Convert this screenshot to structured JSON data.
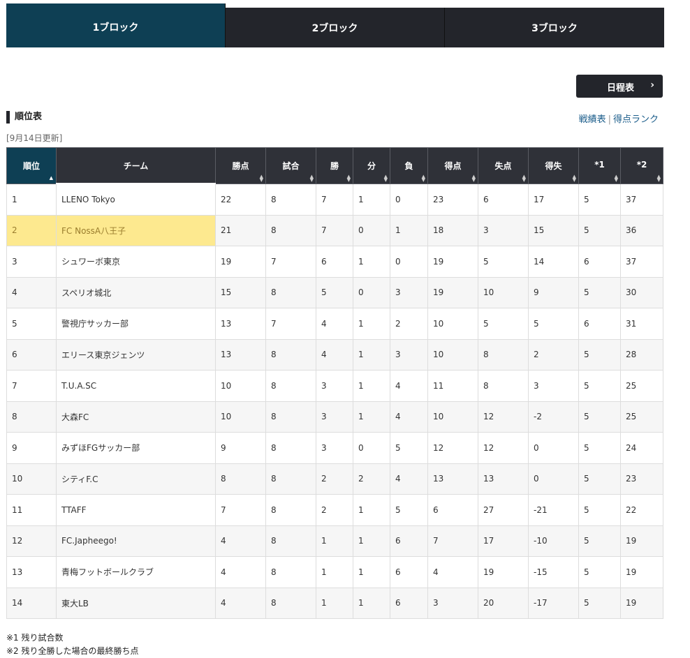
{
  "tabs": [
    {
      "label": "1ブロック",
      "active": true
    },
    {
      "label": "2ブロック",
      "active": false
    },
    {
      "label": "3ブロック",
      "active": false
    }
  ],
  "schedule_button": {
    "label": "日程表",
    "icon": "chevron-right-icon"
  },
  "section_title": "順位表",
  "links": {
    "results": "戦績表",
    "separator": "|",
    "scorers": "得点ランク"
  },
  "updated": "[9月14日更新]",
  "table": {
    "headers": [
      "順位",
      "チーム",
      "勝点",
      "試合",
      "勝",
      "分",
      "負",
      "得点",
      "失点",
      "得失",
      "*1",
      "*2"
    ],
    "rows": [
      [
        "1",
        "LLENO Tokyo",
        "22",
        "8",
        "7",
        "1",
        "0",
        "23",
        "6",
        "17",
        "5",
        "37"
      ],
      [
        "2",
        "FC NossA八王子",
        "21",
        "8",
        "7",
        "0",
        "1",
        "18",
        "3",
        "15",
        "5",
        "36"
      ],
      [
        "3",
        "シュワーボ東京",
        "19",
        "7",
        "6",
        "1",
        "0",
        "19",
        "5",
        "14",
        "6",
        "37"
      ],
      [
        "4",
        "スペリオ城北",
        "15",
        "8",
        "5",
        "0",
        "3",
        "19",
        "10",
        "9",
        "5",
        "30"
      ],
      [
        "5",
        "警視庁サッカー部",
        "13",
        "7",
        "4",
        "1",
        "2",
        "10",
        "5",
        "5",
        "6",
        "31"
      ],
      [
        "6",
        "エリース東京ジェンツ",
        "13",
        "8",
        "4",
        "1",
        "3",
        "10",
        "8",
        "2",
        "5",
        "28"
      ],
      [
        "7",
        "T.U.A.SC",
        "10",
        "8",
        "3",
        "1",
        "4",
        "11",
        "8",
        "3",
        "5",
        "25"
      ],
      [
        "8",
        "大森FC",
        "10",
        "8",
        "3",
        "1",
        "4",
        "10",
        "12",
        "-2",
        "5",
        "25"
      ],
      [
        "9",
        "みずほFGサッカー部",
        "9",
        "8",
        "3",
        "0",
        "5",
        "12",
        "12",
        "0",
        "5",
        "24"
      ],
      [
        "10",
        "シティF.C",
        "8",
        "8",
        "2",
        "2",
        "4",
        "13",
        "13",
        "0",
        "5",
        "23"
      ],
      [
        "11",
        "TTAFF",
        "7",
        "8",
        "2",
        "1",
        "5",
        "6",
        "27",
        "-21",
        "5",
        "22"
      ],
      [
        "12",
        "FC.Japheego!",
        "4",
        "8",
        "1",
        "1",
        "6",
        "7",
        "17",
        "-10",
        "5",
        "19"
      ],
      [
        "13",
        "青梅フットボールクラブ",
        "4",
        "8",
        "1",
        "1",
        "6",
        "4",
        "19",
        "-15",
        "5",
        "19"
      ],
      [
        "14",
        "東大LB",
        "4",
        "8",
        "1",
        "1",
        "6",
        "3",
        "20",
        "-17",
        "5",
        "19"
      ]
    ],
    "highlighted_row_index": 1,
    "highlight_color": "#fde98f"
  },
  "notes": [
    "※1 残り試合数",
    "※2 残り全勝した場合の最終勝ち点"
  ],
  "colors": {
    "tab_active": "#0e3f54",
    "tab_inactive": "#23252b",
    "link": "#1a5c8a"
  }
}
